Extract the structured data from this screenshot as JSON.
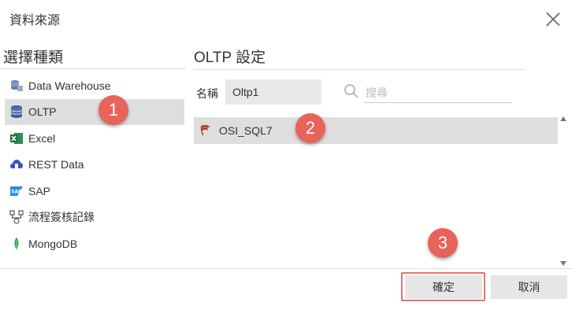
{
  "dialog": {
    "title": "資料來源"
  },
  "left": {
    "heading": "選擇種類",
    "items": [
      {
        "label": "Data Warehouse",
        "icon": "database-stack-icon"
      },
      {
        "label": "OLTP",
        "icon": "database-icon"
      },
      {
        "label": "Excel",
        "icon": "excel-icon"
      },
      {
        "label": "REST Data",
        "icon": "cloud-icon"
      },
      {
        "label": "SAP",
        "icon": "sap-icon"
      },
      {
        "label": "流程簽核記錄",
        "icon": "workflow-icon"
      },
      {
        "label": "MongoDB",
        "icon": "mongodb-leaf-icon"
      }
    ],
    "selected_index": 1
  },
  "right": {
    "heading": "OLTP 設定",
    "name_label": "名稱",
    "name_value": "Oltp1",
    "search_placeholder": "搜尋",
    "connections": [
      {
        "label": "OSI_SQL7",
        "icon": "sql-server-icon"
      }
    ]
  },
  "buttons": {
    "ok": "確定",
    "cancel": "取消"
  },
  "steps": [
    "1",
    "2",
    "3"
  ],
  "colors": {
    "step_badge": "#e8635a",
    "selected_bg": "#dedede",
    "highlight_border": "#e57373"
  }
}
